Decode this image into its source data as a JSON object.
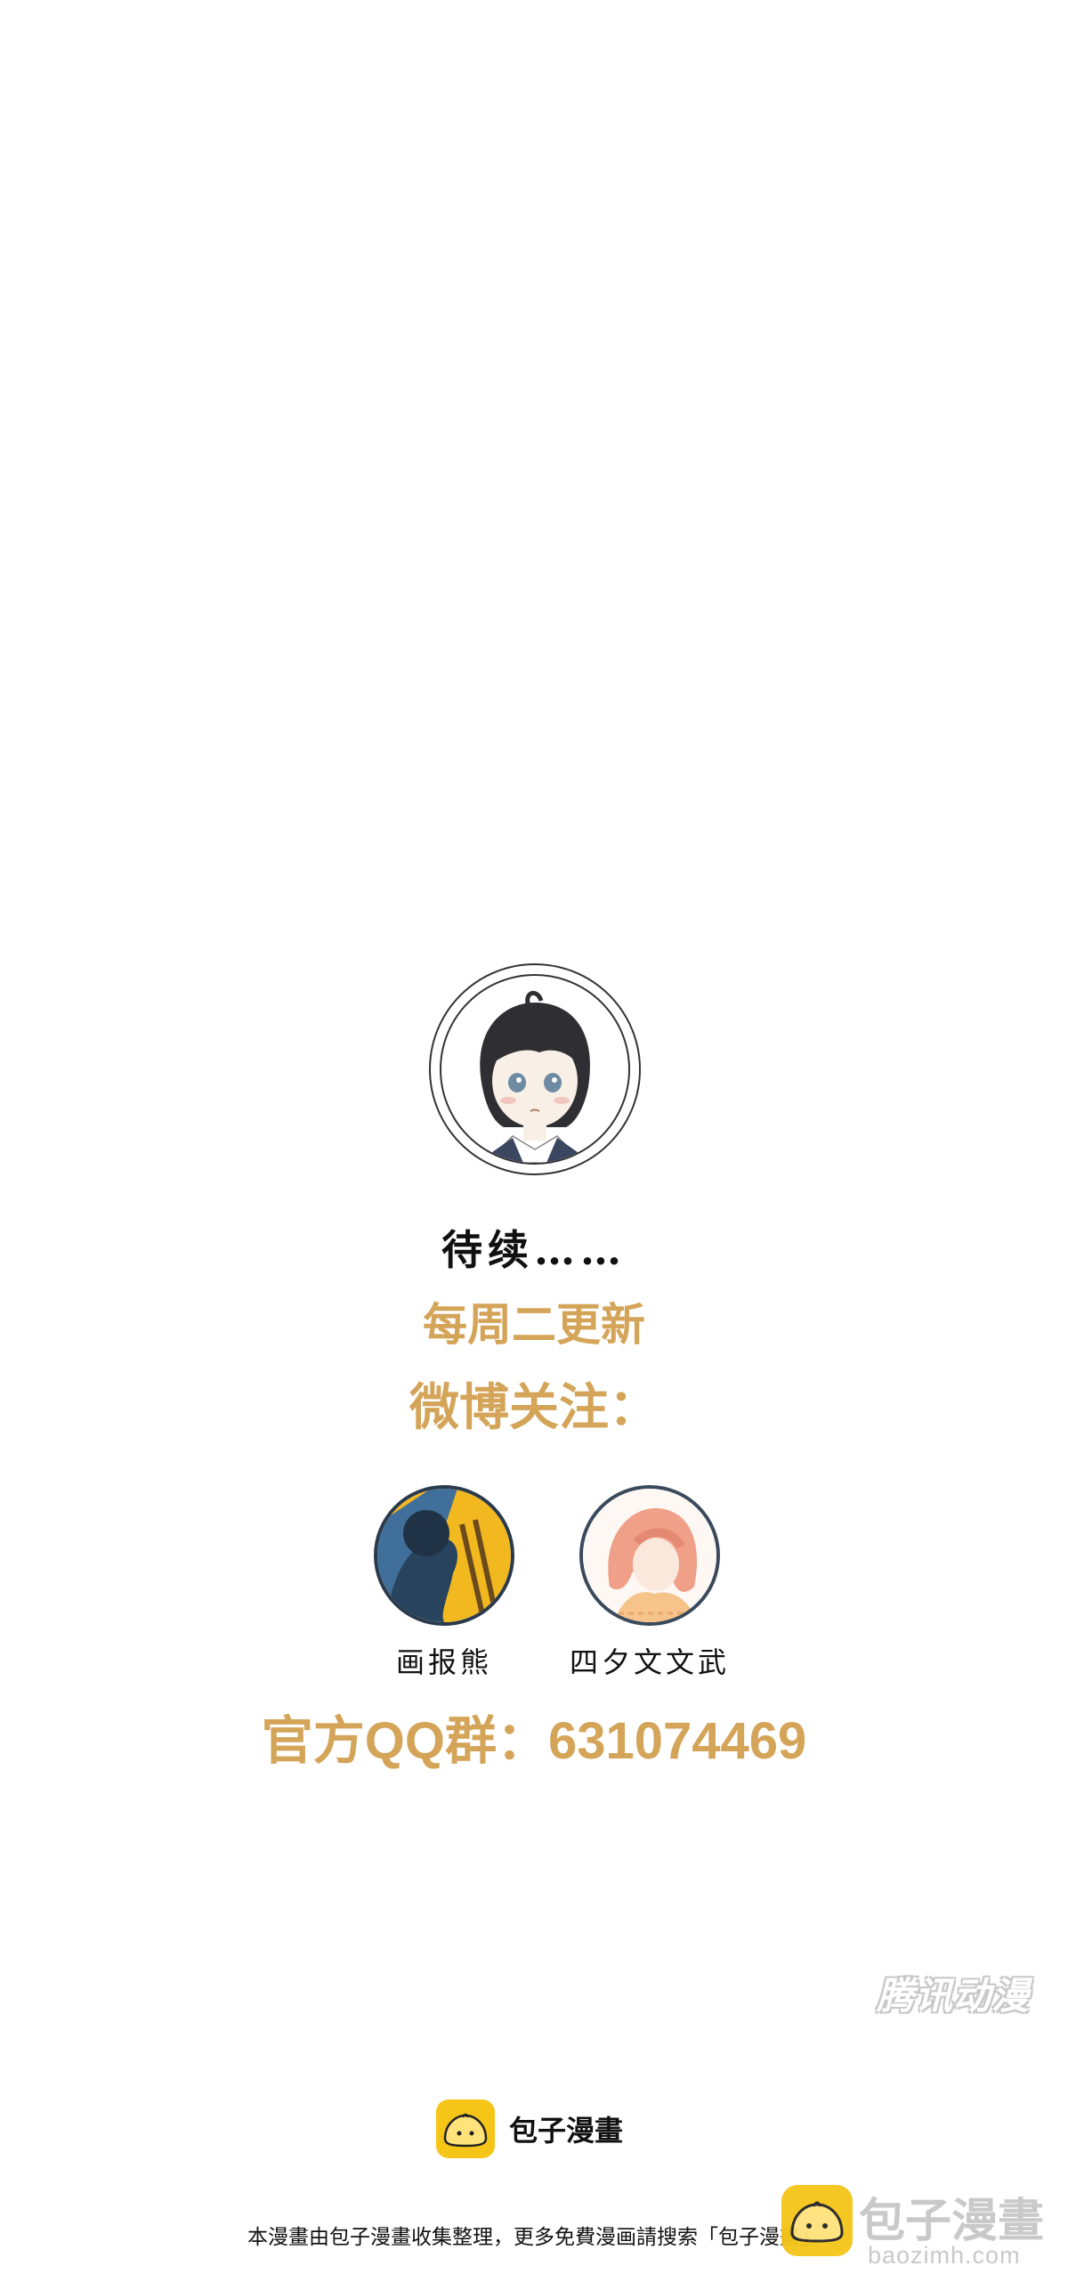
{
  "page": {
    "to_be_continued": "待续……",
    "update_schedule": "每周二更新",
    "weibo_follow": "微博关注：",
    "qq_group": "官方QQ群：631074469"
  },
  "authors": [
    {
      "name": "画报熊"
    },
    {
      "name": "四夕文文武"
    }
  ],
  "watermarks": {
    "tencent": "腾讯动漫",
    "baozi_title": "包子漫畫",
    "baozi_url": "baozimh.com"
  },
  "footer": {
    "logo_text": "包子漫畫",
    "notice": "本漫畫由包子漫畫收集整理，更多免費漫画請搜索「包子漫畫」"
  },
  "colors": {
    "accent": "#d4a458",
    "logo_yellow": "#f5c518"
  }
}
